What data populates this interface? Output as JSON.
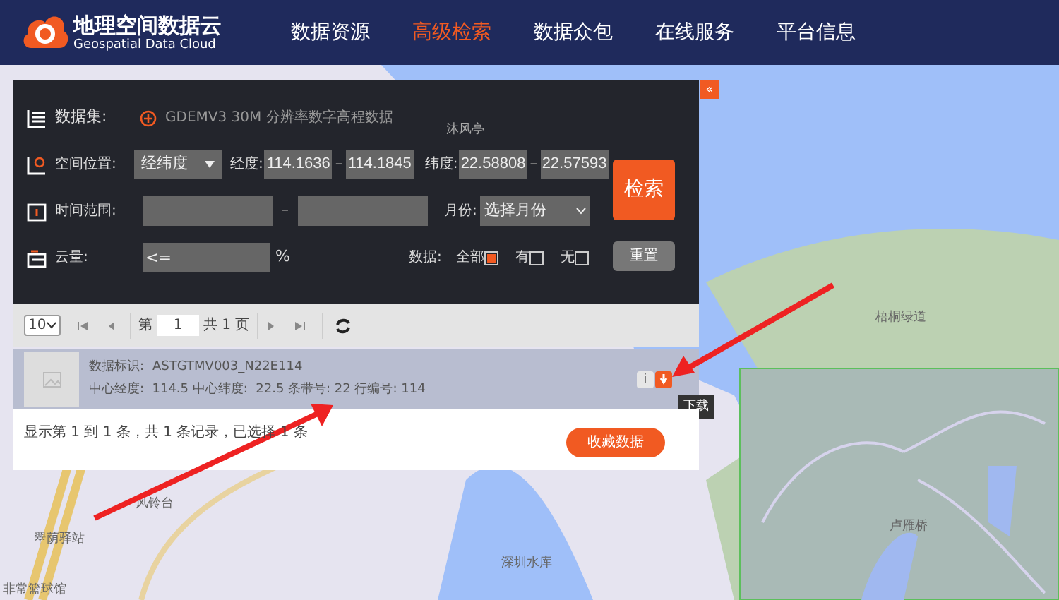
{
  "header": {
    "logo_title": "地理空间数据云",
    "logo_subtitle": "Geospatial Data Cloud",
    "nav": [
      {
        "label": "数据资源",
        "selected": false
      },
      {
        "label": "高级检索",
        "selected": true
      },
      {
        "label": "数据众包",
        "selected": false
      },
      {
        "label": "在线服务",
        "selected": false
      },
      {
        "label": "平台信息",
        "selected": false
      }
    ]
  },
  "search_panel": {
    "collapse": "«",
    "dataset": {
      "label": "数据集:",
      "value": "GDEMV3 30M 分辨率数字高程数据"
    },
    "location": {
      "label": "空间位置:",
      "mode": "经纬度",
      "lon_label": "经度:",
      "lon_from": "114.1636",
      "lon_to": "114.1845",
      "lat_label": "纬度:",
      "lat_from": "22.58808",
      "lat_to": "22.57593",
      "dash": "–"
    },
    "time": {
      "label": "时间范围:",
      "dash": "–",
      "month_label": "月份:",
      "month_placeholder": "选择月份"
    },
    "cloud": {
      "label": "云量:",
      "placeholder": "<=",
      "unit": "%",
      "data_label": "数据:",
      "options": [
        {
          "label": "全部",
          "checked": true
        },
        {
          "label": "有",
          "checked": false
        },
        {
          "label": "无",
          "checked": false
        }
      ]
    },
    "search_button": "检索",
    "reset_button": "重置"
  },
  "pager": {
    "page_size": "10",
    "page_prefix": "第",
    "page": "1",
    "page_total": "共 1 页"
  },
  "records": [
    {
      "id_label": "数据标识:",
      "id": "ASTGTMV003_N22E114",
      "info": "中心经度:  114.5 中心纬度:  22.5 条带号: 22 行编号: 114",
      "info_button": "i",
      "tooltip": "下载"
    }
  ],
  "footer": {
    "summary": "显示第 1 到 1 条，共 1 条记录，已选择 1 条",
    "collect_button": "收藏数据"
  },
  "map": {
    "labels": [
      "沐风亭",
      "梧桐绿道",
      "风铃台",
      "翠荫驿站",
      "非常篮球馆",
      "深圳水库",
      "卢雁桥"
    ]
  }
}
